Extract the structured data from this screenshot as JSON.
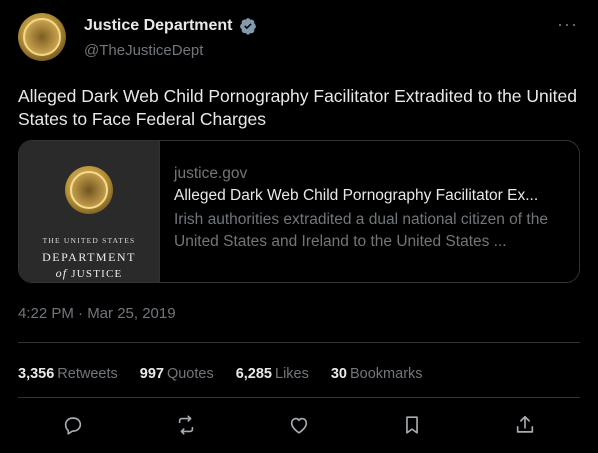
{
  "header": {
    "name": "Justice Department",
    "handle": "@TheJusticeDept",
    "more_label": "···"
  },
  "tweet": {
    "text": "Alleged Dark Web Child Pornography Facilitator Extradited to the United States to Face Federal Charges",
    "timestamp": "4:22 PM · Mar 25, 2019"
  },
  "card": {
    "logo_small": "THE UNITED STATES",
    "logo_line1": "DEPARTMENT",
    "logo_of": "of",
    "logo_line2": "JUSTICE",
    "domain": "justice.gov",
    "title": "Alleged Dark Web Child Pornography Facilitator Ex...",
    "description": "Irish authorities extradited a dual national citizen of the United States and Ireland to the United States ..."
  },
  "stats": {
    "retweets_num": "3,356",
    "retweets_label": "Retweets",
    "quotes_num": "997",
    "quotes_label": "Quotes",
    "likes_num": "6,285",
    "likes_label": "Likes",
    "bookmarks_num": "30",
    "bookmarks_label": "Bookmarks"
  },
  "icons": [
    "reply-icon",
    "retweet-icon",
    "like-icon",
    "bookmark-icon",
    "share-icon"
  ],
  "colors": {
    "background": "#000000",
    "text": "#e7e9ea",
    "muted": "#71767b",
    "border": "#2f3336"
  }
}
